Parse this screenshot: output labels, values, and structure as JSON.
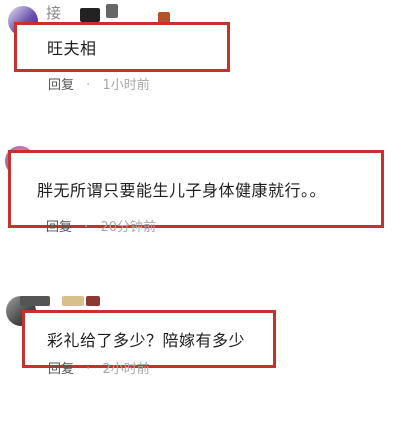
{
  "comments": [
    {
      "username": "接",
      "text": "旺夫相",
      "reply_label": "回复",
      "separator": "·",
      "time": "1小时前"
    },
    {
      "username": "",
      "text": "胖无所谓只要能生儿子身体健康就行。。",
      "reply_label": "回复",
      "separator": "·",
      "time": "20分钟前"
    },
    {
      "username": "",
      "text": "彩礼给了多少？陪嫁有多少",
      "reply_label": "回复",
      "separator": "·",
      "time": "2小时前"
    }
  ],
  "colors": {
    "highlight_border": "#c8302b",
    "avatar_purple": "#7a5ab8",
    "text": "#1e1e1e",
    "meta": "#a8a8a8"
  },
  "icons": [
    "avatar"
  ]
}
